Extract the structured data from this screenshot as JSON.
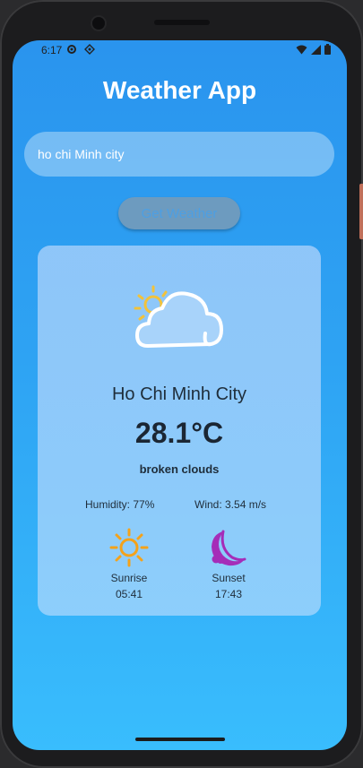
{
  "status_bar": {
    "time": "6:17",
    "icons": [
      "settings-icon",
      "data-saver-icon",
      "wifi-icon",
      "signal-icon",
      "battery-icon"
    ]
  },
  "app": {
    "title": "Weather App"
  },
  "search": {
    "value": "ho chi Minh city",
    "placeholder": ""
  },
  "actions": {
    "get_weather_label": "Get Weather"
  },
  "weather": {
    "icon": "partly-cloudy-icon",
    "city": "Ho Chi Minh City",
    "temperature": "28.1°C",
    "condition": "broken clouds",
    "humidity": "Humidity: 77%",
    "wind": "Wind: 3.54 m/s",
    "sunrise": {
      "label": "Sunrise",
      "time": "05:41",
      "icon": "sun-icon"
    },
    "sunset": {
      "label": "Sunset",
      "time": "17:43",
      "icon": "moon-icon"
    }
  },
  "colors": {
    "background_top": "#2a94ee",
    "background_bottom": "#39bdfd",
    "sun": "#f4a21a",
    "moon": "#a52db8"
  }
}
